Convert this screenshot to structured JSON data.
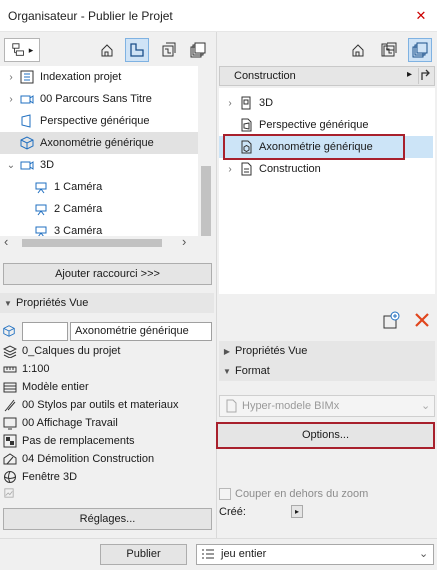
{
  "window": {
    "title": "Organisateur - Publier le Projet",
    "close_glyph": "✕"
  },
  "left_panel": {
    "nav_arrow": "▸",
    "tree": [
      {
        "label": "Indexation projet",
        "chevron": "›",
        "icon": "index-icon"
      },
      {
        "label": "00 Parcours Sans Titre",
        "chevron": "›",
        "icon": "camera-path-icon"
      },
      {
        "label": "Perspective générique",
        "chevron": "",
        "icon": "perspective-icon"
      },
      {
        "label": "Axonométrie générique",
        "chevron": "",
        "icon": "axonometry-icon",
        "selected": true
      },
      {
        "label": "3D",
        "chevron": "⌄",
        "icon": "camera-group-icon"
      },
      {
        "label": "1 Caméra",
        "chevron": "",
        "icon": "camera-icon"
      },
      {
        "label": "2 Caméra",
        "chevron": "",
        "icon": "camera-icon"
      },
      {
        "label": "3 Caméra",
        "chevron": "",
        "icon": "camera-icon"
      }
    ],
    "scroll_left": "‹",
    "scroll_right": "›",
    "add_shortcut_label": "Ajouter raccourci >>>",
    "props_header": "Propriétés Vue",
    "props": {
      "id_value": "",
      "name_value": "Axonométrie générique",
      "rows": [
        {
          "label": "0_Calques du projet",
          "icon": "layers-icon"
        },
        {
          "label": "1:100",
          "icon": "scale-icon"
        },
        {
          "label": "Modèle entier",
          "icon": "model-icon"
        },
        {
          "label": "00 Stylos par outils et materiaux",
          "icon": "pen-icon"
        },
        {
          "label": "00 Affichage Travail",
          "icon": "display-icon"
        },
        {
          "label": "Pas de remplacements",
          "icon": "override-icon"
        },
        {
          "label": "04 Démolition Construction",
          "icon": "renovation-icon"
        },
        {
          "label": "Fenêtre 3D",
          "icon": "3d-window-icon"
        }
      ]
    },
    "settings_label": "Réglages..."
  },
  "right_panel": {
    "breadcrumb": "Construction",
    "breadcrumb_arrow": "▸",
    "tree": [
      {
        "label": "3D",
        "chevron": "›",
        "icon": "folder-3d-icon"
      },
      {
        "label": "Perspective générique",
        "chevron": "",
        "icon": "perspective-doc-icon"
      },
      {
        "label": "Axonométrie générique",
        "chevron": "",
        "icon": "axonometry-doc-icon",
        "selected": true
      },
      {
        "label": "Construction",
        "chevron": "›",
        "icon": "folder-doc-icon"
      }
    ],
    "props_header": "Propriétés Vue",
    "format_header": "Format",
    "format_value": "Hyper-modele BIMx",
    "options_label": "Options...",
    "crop_label": "Couper en dehors  du zoom",
    "created_label": "Créé:",
    "created_arrow": "▸"
  },
  "bottom": {
    "publish_label": "Publier",
    "set_value": "jeu entier"
  },
  "colors": {
    "accent_red": "#a8202c",
    "selection_blue": "#cce4f7",
    "icon_blue": "#1f6fc0"
  }
}
